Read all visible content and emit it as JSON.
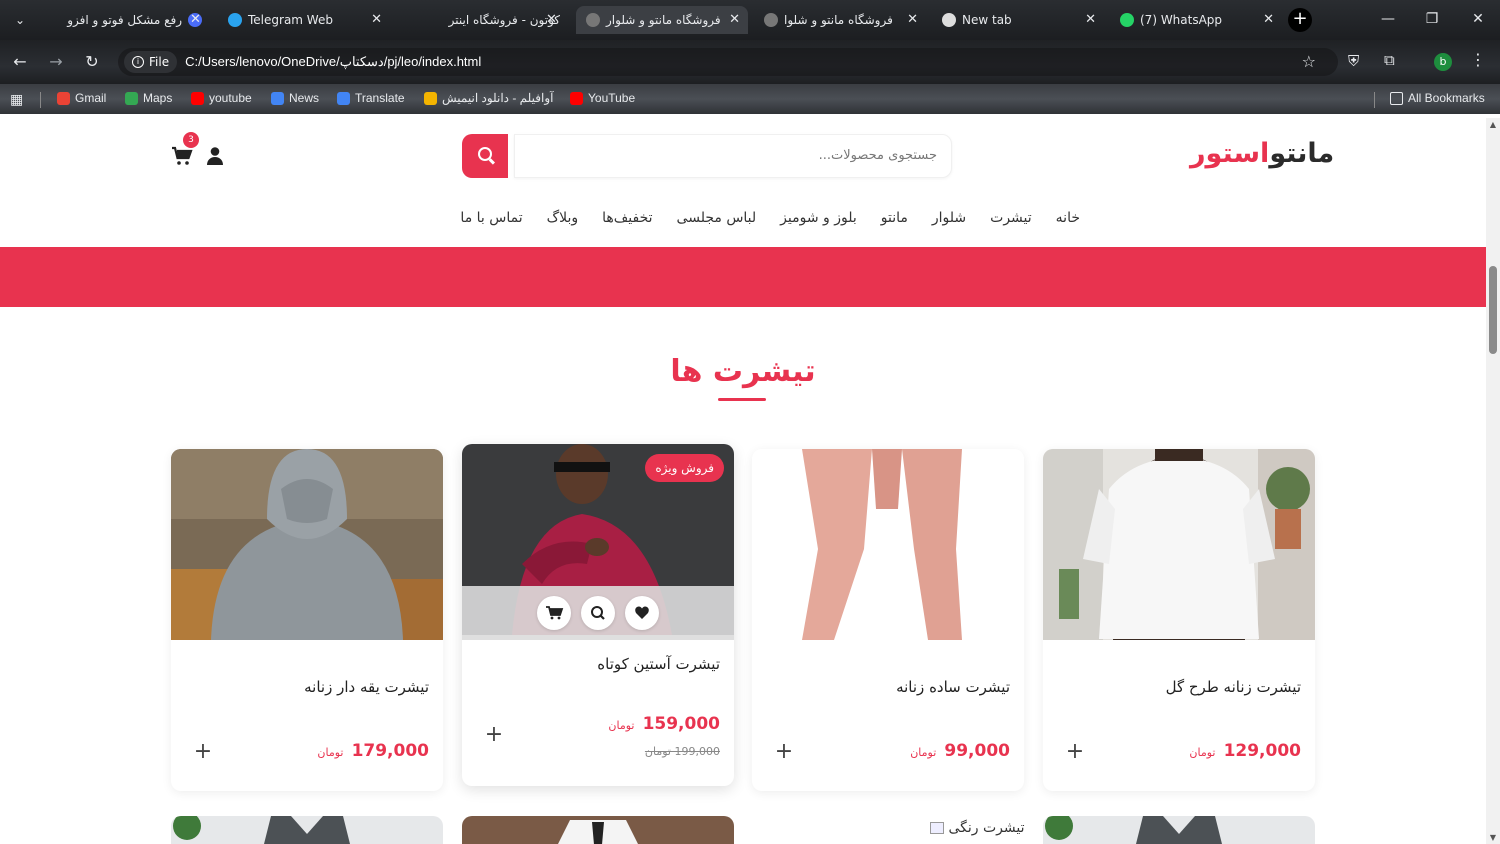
{
  "browser": {
    "tabs": [
      {
        "title": "رفع مشکل فوتو و افزو",
        "active": false,
        "favicon_color": "#4a6cf7"
      },
      {
        "title": "Telegram Web",
        "active": false,
        "favicon_color": "#2aa3ef"
      },
      {
        "title": "کوتون - فروشگاه اینتر",
        "active": false,
        "favicon_color": "#888888"
      },
      {
        "title": "فروشگاه مانتو و شلوار",
        "active": true,
        "favicon_color": "#888888"
      },
      {
        "title": "فروشگاه مانتو و شلوا",
        "active": false,
        "favicon_color": "#888888"
      },
      {
        "title": "New tab",
        "active": false,
        "favicon_color": "#dddddd"
      },
      {
        "title": "(7) WhatsApp",
        "active": false,
        "favicon_color": "#25d366"
      }
    ],
    "new_tab": "+",
    "address": {
      "scheme_label": "File",
      "url": "C:/Users/lenovo/OneDrive/دسکتاپ/pj/leo/index.html"
    },
    "profile_initial": "b",
    "bookmarks": [
      {
        "label": "Gmail",
        "color": "#ea4335"
      },
      {
        "label": "Maps",
        "color": "#34a853"
      },
      {
        "label": "youtube",
        "color": "#ff0000"
      },
      {
        "label": "News",
        "color": "#4285f4"
      },
      {
        "label": "Translate",
        "color": "#4285f4"
      },
      {
        "label": "آوافیلم - دانلود انیمیش",
        "color": "#f4b400"
      },
      {
        "label": "YouTube",
        "color": "#ff0000"
      }
    ],
    "all_bookmarks": "All Bookmarks"
  },
  "header": {
    "logo_part1": "مانتو",
    "logo_part2": "استور",
    "search_placeholder": "جستجوی محصولات...",
    "cart_count": "3"
  },
  "nav": [
    "خانه",
    "تیشرت",
    "شلوار",
    "مانتو",
    "بلوز و شومیز",
    "لباس مجلسی",
    "تخفیف‌ها",
    "وبلاگ",
    "تماس با ما"
  ],
  "section": {
    "title": "تیشرت ها"
  },
  "products": [
    {
      "name": "تیشرت زنانه طرح گل",
      "price": "129,000",
      "currency": "تومان"
    },
    {
      "name": "تیشرت ساده زنانه",
      "price": "99,000",
      "currency": "تومان"
    },
    {
      "name": "تیشرت آستین کوتاه",
      "price": "159,000",
      "old_price": "199,000",
      "currency": "تومان",
      "badge": "فروش ویژه"
    },
    {
      "name": "تیشرت یقه دار زنانه",
      "price": "179,000",
      "currency": "تومان"
    }
  ],
  "second_row": {
    "broken_image_alt": "تیشرت رنگی"
  },
  "colors": {
    "accent": "#e8334f"
  }
}
